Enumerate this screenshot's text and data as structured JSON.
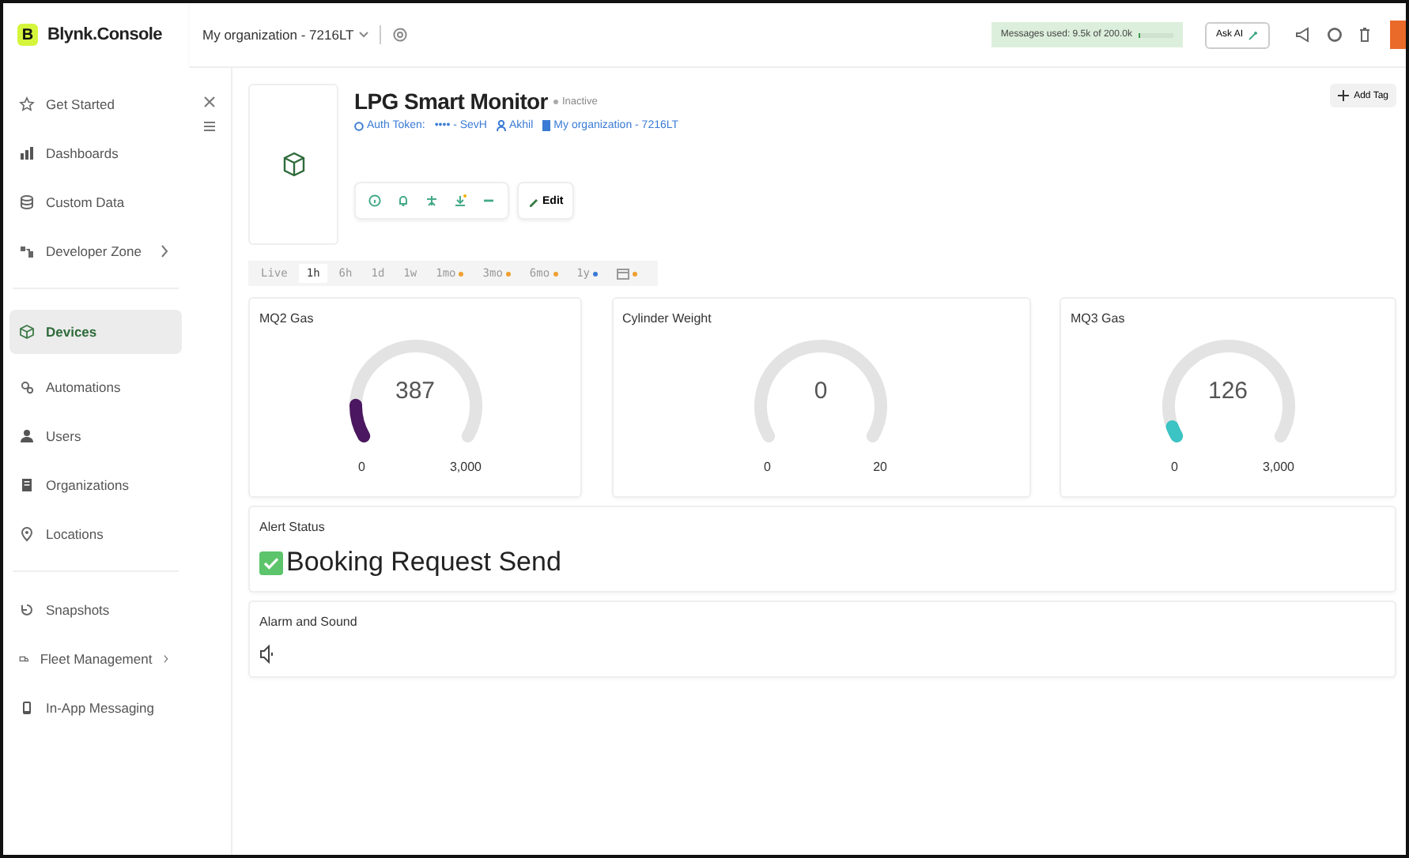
{
  "brand": {
    "logo_letter": "B",
    "name": "Blynk.Console"
  },
  "sidebar": {
    "sections": [
      {
        "items": [
          {
            "label": "Get Started",
            "selected": false,
            "has_submenu": false
          },
          {
            "label": "Dashboards",
            "selected": false,
            "has_submenu": false
          },
          {
            "label": "Custom Data",
            "selected": false,
            "has_submenu": false
          },
          {
            "label": "Developer Zone",
            "selected": false,
            "has_submenu": true
          }
        ]
      },
      {
        "items": [
          {
            "label": "Devices",
            "selected": true,
            "has_submenu": false
          },
          {
            "label": "Automations",
            "selected": false,
            "has_submenu": false
          },
          {
            "label": "Users",
            "selected": false,
            "has_submenu": false
          },
          {
            "label": "Organizations",
            "selected": false,
            "has_submenu": false
          },
          {
            "label": "Locations",
            "selected": false,
            "has_submenu": false
          }
        ]
      },
      {
        "items": [
          {
            "label": "Snapshots",
            "selected": false,
            "has_submenu": false
          },
          {
            "label": "Fleet Management",
            "selected": false,
            "has_submenu": true
          },
          {
            "label": "In-App Messaging",
            "selected": false,
            "has_submenu": false
          }
        ]
      }
    ]
  },
  "topbar": {
    "organization": "My organization - 7216LT",
    "messages": {
      "text": "Messages used: 9.5k of 200.0k",
      "level": 0.05
    },
    "ask_ai": "Ask AI"
  },
  "device": {
    "name": "LPG Smart Monitor",
    "status": "Inactive",
    "auth_token_label": "Auth Token:",
    "auth_token": "•••• - SevH",
    "owner": "Akhil",
    "organization": "My organization - 7216LT",
    "edit": "Edit",
    "add_tag": "Add Tag"
  },
  "time_ranges": [
    {
      "kind": "text",
      "label": "Live",
      "selected": false
    },
    {
      "kind": "text",
      "label": "1h",
      "selected": true
    },
    {
      "kind": "text",
      "label": "6h",
      "selected": false
    },
    {
      "kind": "text",
      "label": "1d",
      "selected": false
    },
    {
      "kind": "text",
      "label": "1w",
      "selected": false
    },
    {
      "kind": "text",
      "label": "1mo",
      "selected": false,
      "color": "#f0a030"
    },
    {
      "kind": "text",
      "label": "3mo",
      "selected": false,
      "color": "#f0a030"
    },
    {
      "kind": "text",
      "label": "6mo",
      "selected": false,
      "color": "#f0a030"
    },
    {
      "kind": "text",
      "label": "1y",
      "selected": false,
      "color": "#3a7bd5"
    },
    {
      "kind": "icon",
      "selected": false,
      "color": "#f0a030"
    }
  ],
  "widgets": [
    {
      "kind": "gauge",
      "title": "MQ2 Gas",
      "value": "387",
      "min": "0",
      "max": "3,000",
      "color": "#4b1760"
    },
    {
      "kind": "gauge",
      "title": "Cylinder Weight",
      "value": "0",
      "min": "0",
      "max": "20"
    },
    {
      "kind": "gauge",
      "title": "MQ3 Gas",
      "value": "126",
      "min": "0",
      "max": "3,000",
      "color": "#3cc3c3"
    },
    {
      "kind": "status",
      "title": "Alert Status",
      "text": "Booking Request Send"
    },
    {
      "kind": "sound",
      "title": "Alarm and Sound"
    }
  ]
}
